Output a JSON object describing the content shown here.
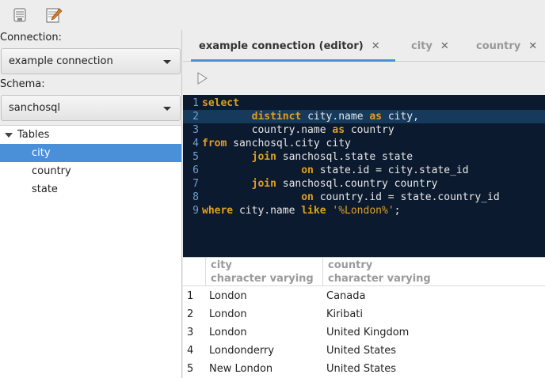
{
  "toolbar": {
    "buttons": [
      {
        "icon": "database-connection-icon"
      },
      {
        "icon": "edit-notepad-icon"
      }
    ]
  },
  "sidebar": {
    "connection_label": "Connection:",
    "connection_value": "example connection",
    "schema_label": "Schema:",
    "schema_value": "sanchosql",
    "tree_root": "Tables",
    "tables": [
      "city",
      "country",
      "state"
    ],
    "selected_table": "city"
  },
  "tabs": [
    {
      "label": "example connection (editor)",
      "active": true
    },
    {
      "label": "city",
      "active": false
    },
    {
      "label": "country",
      "active": false
    }
  ],
  "editor": {
    "current_line": 2,
    "lines": [
      [
        {
          "t": "kw",
          "v": "select"
        }
      ],
      [
        {
          "t": "pl",
          "v": "        "
        },
        {
          "t": "kw",
          "v": "distinct"
        },
        {
          "t": "pl",
          "v": " city.name "
        },
        {
          "t": "kw",
          "v": "as"
        },
        {
          "t": "pl",
          "v": " city,"
        }
      ],
      [
        {
          "t": "pl",
          "v": "        country.name "
        },
        {
          "t": "kw",
          "v": "as"
        },
        {
          "t": "pl",
          "v": " country"
        }
      ],
      [
        {
          "t": "kw",
          "v": "from"
        },
        {
          "t": "pl",
          "v": " sanchosql.city city"
        }
      ],
      [
        {
          "t": "pl",
          "v": "        "
        },
        {
          "t": "kw",
          "v": "join"
        },
        {
          "t": "pl",
          "v": " sanchosql.state state"
        }
      ],
      [
        {
          "t": "pl",
          "v": "                "
        },
        {
          "t": "kw",
          "v": "on"
        },
        {
          "t": "pl",
          "v": " state.id = city.state_id"
        }
      ],
      [
        {
          "t": "pl",
          "v": "        "
        },
        {
          "t": "kw",
          "v": "join"
        },
        {
          "t": "pl",
          "v": " sanchosql.country country"
        }
      ],
      [
        {
          "t": "pl",
          "v": "                "
        },
        {
          "t": "kw",
          "v": "on"
        },
        {
          "t": "pl",
          "v": " country.id = state.country_id"
        }
      ],
      [
        {
          "t": "kw",
          "v": "where"
        },
        {
          "t": "pl",
          "v": " city.name "
        },
        {
          "t": "kw",
          "v": "like"
        },
        {
          "t": "pl",
          "v": " "
        },
        {
          "t": "str",
          "v": "'%London%'"
        },
        {
          "t": "pl",
          "v": ";"
        }
      ]
    ]
  },
  "results": {
    "columns": [
      {
        "name": "city",
        "type": "character varying"
      },
      {
        "name": "country",
        "type": "character varying"
      }
    ],
    "rows": [
      [
        "1",
        "London",
        "Canada"
      ],
      [
        "2",
        "London",
        "Kiribati"
      ],
      [
        "3",
        "London",
        "United Kingdom"
      ],
      [
        "4",
        "Londonderry",
        "United States"
      ],
      [
        "5",
        "New London",
        "United States"
      ]
    ]
  },
  "colors": {
    "accent": "#4a90d9",
    "editor_bg": "#0b1a2e",
    "keyword": "#e0a020",
    "current_line": "#153a5c"
  }
}
